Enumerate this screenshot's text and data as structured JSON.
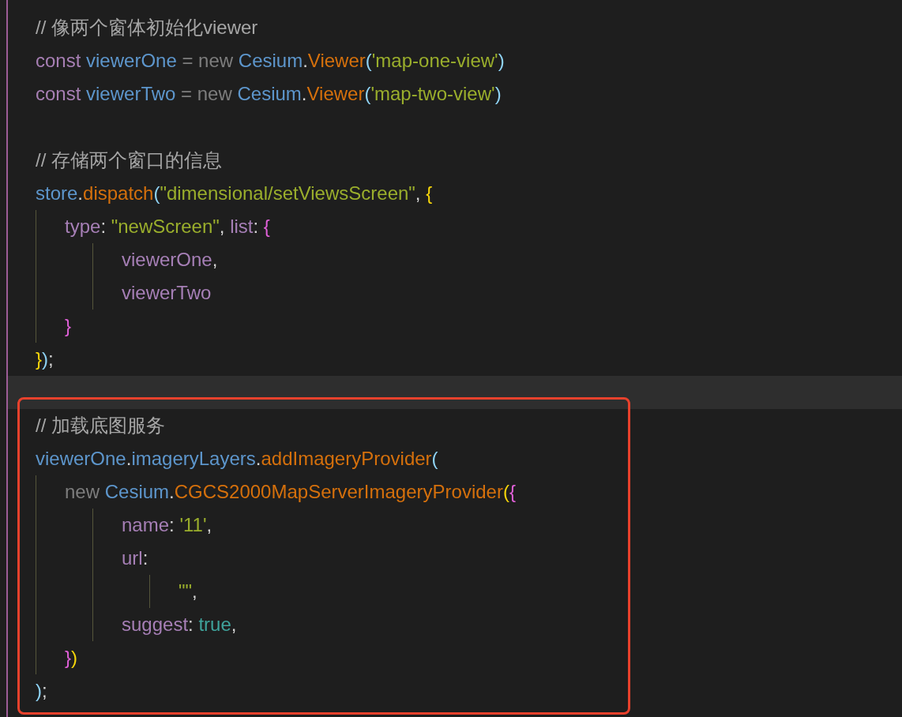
{
  "editor": {
    "blocks": [
      {
        "boxed": false,
        "lines": [
          {
            "current": false,
            "tokens": [
              {
                "kind": "comment",
                "text": "// 像两个窗体初始化viewer"
              }
            ]
          },
          {
            "current": false,
            "tokens": [
              {
                "kind": "keyword",
                "text": "const "
              },
              {
                "kind": "variable",
                "text": "viewerOne "
              },
              {
                "kind": "operator",
                "text": "= "
              },
              {
                "kind": "new",
                "text": "new "
              },
              {
                "kind": "variable",
                "text": "Cesium"
              },
              {
                "kind": "punct",
                "text": "."
              },
              {
                "kind": "function",
                "text": "Viewer"
              },
              {
                "kind": "paren",
                "text": "("
              },
              {
                "kind": "string",
                "text": "'map-one-view'"
              },
              {
                "kind": "paren",
                "text": ")"
              }
            ]
          },
          {
            "current": false,
            "tokens": [
              {
                "kind": "keyword",
                "text": "const "
              },
              {
                "kind": "variable",
                "text": "viewerTwo "
              },
              {
                "kind": "operator",
                "text": "= "
              },
              {
                "kind": "new",
                "text": "new "
              },
              {
                "kind": "variable",
                "text": "Cesium"
              },
              {
                "kind": "punct",
                "text": "."
              },
              {
                "kind": "function",
                "text": "Viewer"
              },
              {
                "kind": "paren",
                "text": "("
              },
              {
                "kind": "string",
                "text": "'map-two-view'"
              },
              {
                "kind": "paren",
                "text": ")"
              }
            ]
          },
          {
            "current": false
          },
          {
            "current": false,
            "tokens": [
              {
                "kind": "comment",
                "text": "// 存储两个窗口的信息"
              }
            ]
          },
          {
            "current": false,
            "tokens": [
              {
                "kind": "variable",
                "text": "store"
              },
              {
                "kind": "punct",
                "text": "."
              },
              {
                "kind": "function",
                "text": "dispatch"
              },
              {
                "kind": "paren",
                "text": "("
              },
              {
                "kind": "string",
                "text": "\"dimensional/setViewsScreen\""
              },
              {
                "kind": "punct",
                "text": ", "
              },
              {
                "kind": "brace",
                "text": "{"
              }
            ],
            "children": [
              {
                "current": false,
                "tokens": [
                  {
                    "kind": "property",
                    "text": "type"
                  },
                  {
                    "kind": "punct",
                    "text": ": "
                  },
                  {
                    "kind": "string",
                    "text": "\"newScreen\""
                  },
                  {
                    "kind": "punct",
                    "text": ", "
                  },
                  {
                    "kind": "property",
                    "text": "list"
                  },
                  {
                    "kind": "punct",
                    "text": ": "
                  },
                  {
                    "kind": "brace2",
                    "text": "{"
                  }
                ],
                "children": [
                  {
                    "current": false,
                    "tokens": [
                      {
                        "kind": "property",
                        "text": "viewerOne"
                      },
                      {
                        "kind": "punct",
                        "text": ","
                      }
                    ]
                  },
                  {
                    "current": false,
                    "tokens": [
                      {
                        "kind": "property",
                        "text": "viewerTwo"
                      }
                    ]
                  }
                ]
              },
              {
                "current": false,
                "tokens": [
                  {
                    "kind": "brace2",
                    "text": "}"
                  }
                ]
              }
            ]
          },
          {
            "current": false,
            "tokens": [
              {
                "kind": "brace",
                "text": "}"
              },
              {
                "kind": "paren",
                "text": ")"
              },
              {
                "kind": "punct",
                "text": ";"
              }
            ]
          },
          {
            "current": true
          }
        ]
      },
      {
        "boxed": true,
        "lines": [
          {
            "current": false,
            "tokens": [
              {
                "kind": "comment",
                "text": "// 加载底图服务"
              }
            ]
          },
          {
            "current": false,
            "tokens": [
              {
                "kind": "variable",
                "text": "viewerOne"
              },
              {
                "kind": "punct",
                "text": "."
              },
              {
                "kind": "variable",
                "text": "imageryLayers"
              },
              {
                "kind": "punct",
                "text": "."
              },
              {
                "kind": "function",
                "text": "addImageryProvider"
              },
              {
                "kind": "paren",
                "text": "("
              }
            ],
            "children": [
              {
                "current": false,
                "tokens": [
                  {
                    "kind": "new",
                    "text": "new "
                  },
                  {
                    "kind": "variable",
                    "text": "Cesium"
                  },
                  {
                    "kind": "punct",
                    "text": "."
                  },
                  {
                    "kind": "function",
                    "text": "CGCS2000MapServerImageryProvider"
                  },
                  {
                    "kind": "brace",
                    "text": "("
                  },
                  {
                    "kind": "brace2",
                    "text": "{"
                  }
                ],
                "children": [
                  {
                    "current": false,
                    "tokens": [
                      {
                        "kind": "property",
                        "text": "name"
                      },
                      {
                        "kind": "punct",
                        "text": ": "
                      },
                      {
                        "kind": "string",
                        "text": "'11'"
                      },
                      {
                        "kind": "punct",
                        "text": ","
                      }
                    ]
                  },
                  {
                    "current": false,
                    "tokens": [
                      {
                        "kind": "property",
                        "text": "url"
                      },
                      {
                        "kind": "punct",
                        "text": ":"
                      }
                    ],
                    "children": [
                      {
                        "current": false,
                        "tokens": [
                          {
                            "kind": "string",
                            "text": "\"\""
                          },
                          {
                            "kind": "punct",
                            "text": ","
                          }
                        ]
                      }
                    ]
                  },
                  {
                    "current": false,
                    "tokens": [
                      {
                        "kind": "property",
                        "text": "suggest"
                      },
                      {
                        "kind": "punct",
                        "text": ": "
                      },
                      {
                        "kind": "bool",
                        "text": "true"
                      },
                      {
                        "kind": "punct",
                        "text": ","
                      }
                    ]
                  }
                ]
              },
              {
                "current": false,
                "tokens": [
                  {
                    "kind": "brace2",
                    "text": "}"
                  },
                  {
                    "kind": "brace",
                    "text": ")"
                  }
                ]
              }
            ]
          },
          {
            "current": false,
            "tokens": [
              {
                "kind": "paren",
                "text": ")"
              },
              {
                "kind": "punct",
                "text": ";"
              }
            ]
          }
        ]
      }
    ]
  }
}
